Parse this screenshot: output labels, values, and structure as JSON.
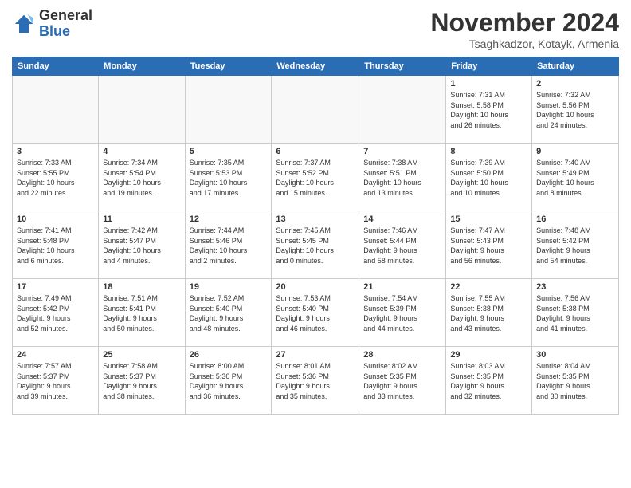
{
  "header": {
    "logo_general": "General",
    "logo_blue": "Blue",
    "month_title": "November 2024",
    "subtitle": "Tsaghkadzor, Kotayk, Armenia"
  },
  "days_of_week": [
    "Sunday",
    "Monday",
    "Tuesday",
    "Wednesday",
    "Thursday",
    "Friday",
    "Saturday"
  ],
  "weeks": [
    [
      {
        "day": "",
        "info": ""
      },
      {
        "day": "",
        "info": ""
      },
      {
        "day": "",
        "info": ""
      },
      {
        "day": "",
        "info": ""
      },
      {
        "day": "",
        "info": ""
      },
      {
        "day": "1",
        "info": "Sunrise: 7:31 AM\nSunset: 5:58 PM\nDaylight: 10 hours\nand 26 minutes."
      },
      {
        "day": "2",
        "info": "Sunrise: 7:32 AM\nSunset: 5:56 PM\nDaylight: 10 hours\nand 24 minutes."
      }
    ],
    [
      {
        "day": "3",
        "info": "Sunrise: 7:33 AM\nSunset: 5:55 PM\nDaylight: 10 hours\nand 22 minutes."
      },
      {
        "day": "4",
        "info": "Sunrise: 7:34 AM\nSunset: 5:54 PM\nDaylight: 10 hours\nand 19 minutes."
      },
      {
        "day": "5",
        "info": "Sunrise: 7:35 AM\nSunset: 5:53 PM\nDaylight: 10 hours\nand 17 minutes."
      },
      {
        "day": "6",
        "info": "Sunrise: 7:37 AM\nSunset: 5:52 PM\nDaylight: 10 hours\nand 15 minutes."
      },
      {
        "day": "7",
        "info": "Sunrise: 7:38 AM\nSunset: 5:51 PM\nDaylight: 10 hours\nand 13 minutes."
      },
      {
        "day": "8",
        "info": "Sunrise: 7:39 AM\nSunset: 5:50 PM\nDaylight: 10 hours\nand 10 minutes."
      },
      {
        "day": "9",
        "info": "Sunrise: 7:40 AM\nSunset: 5:49 PM\nDaylight: 10 hours\nand 8 minutes."
      }
    ],
    [
      {
        "day": "10",
        "info": "Sunrise: 7:41 AM\nSunset: 5:48 PM\nDaylight: 10 hours\nand 6 minutes."
      },
      {
        "day": "11",
        "info": "Sunrise: 7:42 AM\nSunset: 5:47 PM\nDaylight: 10 hours\nand 4 minutes."
      },
      {
        "day": "12",
        "info": "Sunrise: 7:44 AM\nSunset: 5:46 PM\nDaylight: 10 hours\nand 2 minutes."
      },
      {
        "day": "13",
        "info": "Sunrise: 7:45 AM\nSunset: 5:45 PM\nDaylight: 10 hours\nand 0 minutes."
      },
      {
        "day": "14",
        "info": "Sunrise: 7:46 AM\nSunset: 5:44 PM\nDaylight: 9 hours\nand 58 minutes."
      },
      {
        "day": "15",
        "info": "Sunrise: 7:47 AM\nSunset: 5:43 PM\nDaylight: 9 hours\nand 56 minutes."
      },
      {
        "day": "16",
        "info": "Sunrise: 7:48 AM\nSunset: 5:42 PM\nDaylight: 9 hours\nand 54 minutes."
      }
    ],
    [
      {
        "day": "17",
        "info": "Sunrise: 7:49 AM\nSunset: 5:42 PM\nDaylight: 9 hours\nand 52 minutes."
      },
      {
        "day": "18",
        "info": "Sunrise: 7:51 AM\nSunset: 5:41 PM\nDaylight: 9 hours\nand 50 minutes."
      },
      {
        "day": "19",
        "info": "Sunrise: 7:52 AM\nSunset: 5:40 PM\nDaylight: 9 hours\nand 48 minutes."
      },
      {
        "day": "20",
        "info": "Sunrise: 7:53 AM\nSunset: 5:40 PM\nDaylight: 9 hours\nand 46 minutes."
      },
      {
        "day": "21",
        "info": "Sunrise: 7:54 AM\nSunset: 5:39 PM\nDaylight: 9 hours\nand 44 minutes."
      },
      {
        "day": "22",
        "info": "Sunrise: 7:55 AM\nSunset: 5:38 PM\nDaylight: 9 hours\nand 43 minutes."
      },
      {
        "day": "23",
        "info": "Sunrise: 7:56 AM\nSunset: 5:38 PM\nDaylight: 9 hours\nand 41 minutes."
      }
    ],
    [
      {
        "day": "24",
        "info": "Sunrise: 7:57 AM\nSunset: 5:37 PM\nDaylight: 9 hours\nand 39 minutes."
      },
      {
        "day": "25",
        "info": "Sunrise: 7:58 AM\nSunset: 5:37 PM\nDaylight: 9 hours\nand 38 minutes."
      },
      {
        "day": "26",
        "info": "Sunrise: 8:00 AM\nSunset: 5:36 PM\nDaylight: 9 hours\nand 36 minutes."
      },
      {
        "day": "27",
        "info": "Sunrise: 8:01 AM\nSunset: 5:36 PM\nDaylight: 9 hours\nand 35 minutes."
      },
      {
        "day": "28",
        "info": "Sunrise: 8:02 AM\nSunset: 5:35 PM\nDaylight: 9 hours\nand 33 minutes."
      },
      {
        "day": "29",
        "info": "Sunrise: 8:03 AM\nSunset: 5:35 PM\nDaylight: 9 hours\nand 32 minutes."
      },
      {
        "day": "30",
        "info": "Sunrise: 8:04 AM\nSunset: 5:35 PM\nDaylight: 9 hours\nand 30 minutes."
      }
    ]
  ]
}
